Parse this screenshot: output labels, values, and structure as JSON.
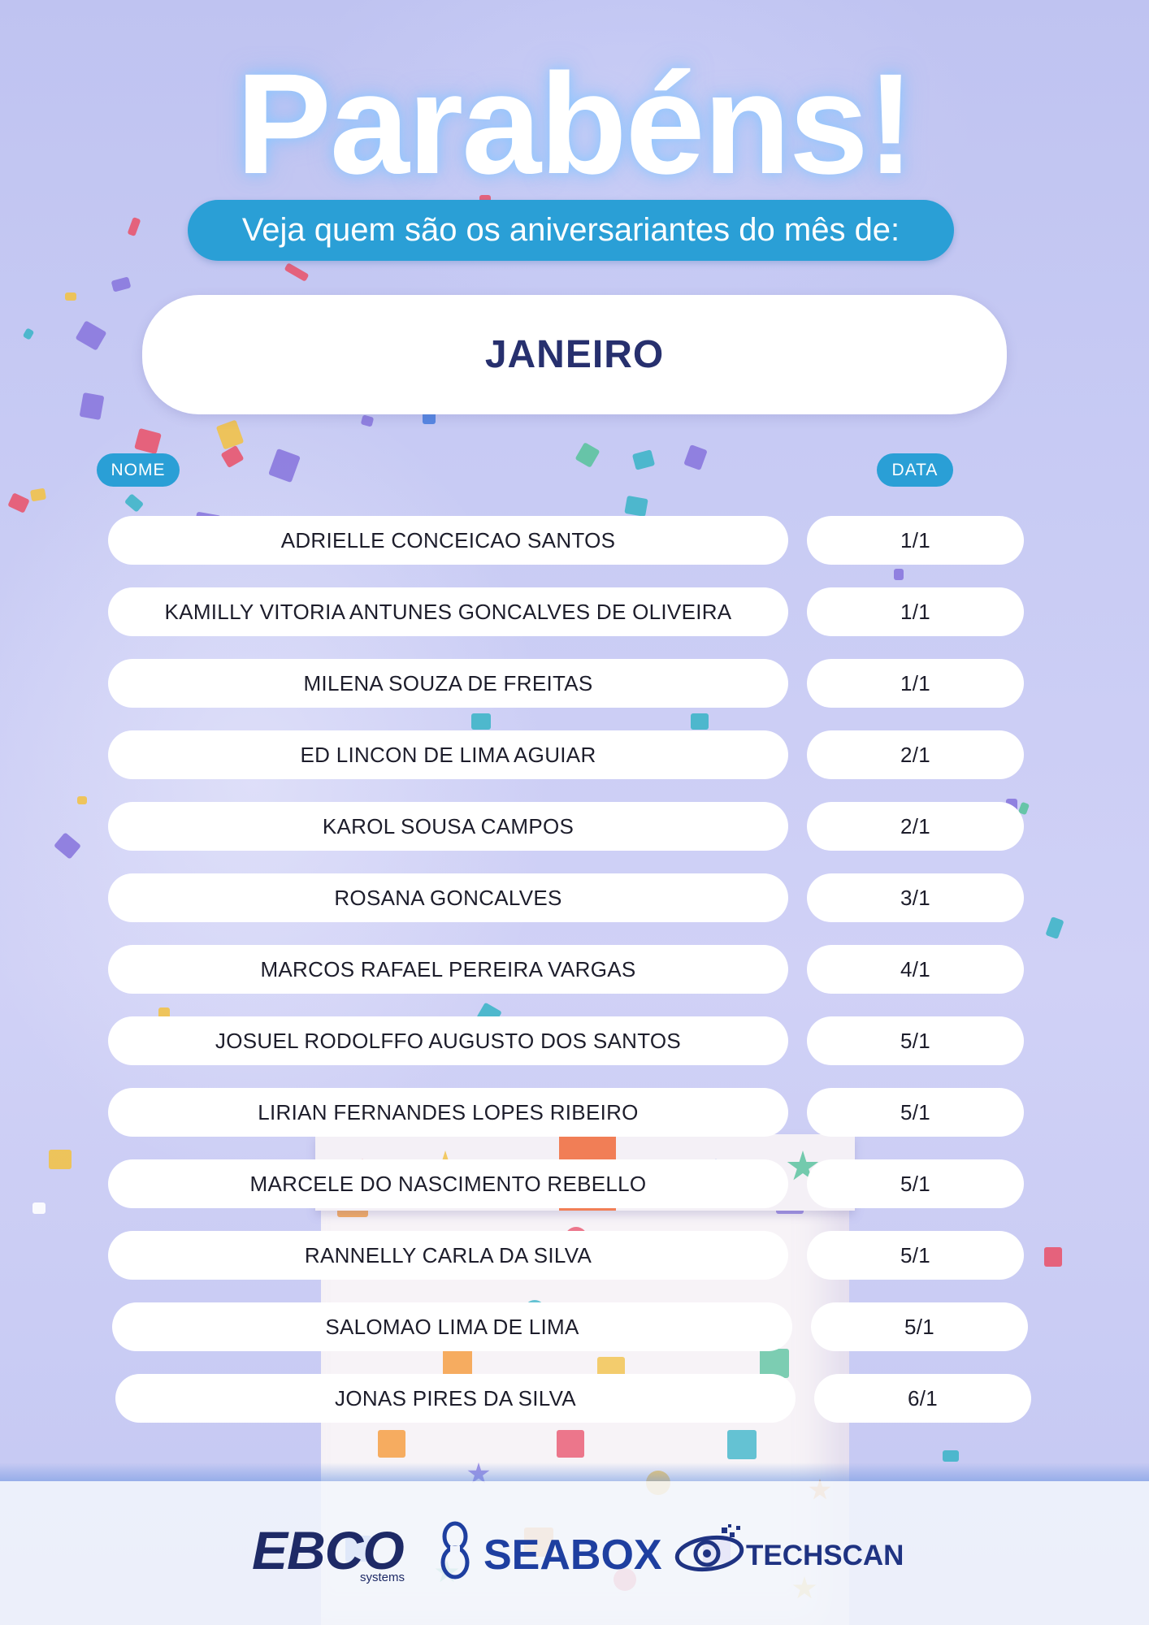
{
  "header": {
    "title": "Parabéns!",
    "subtitle": "Veja quem são os aniversariantes do mês de:"
  },
  "month": "JANEIRO",
  "table": {
    "name_header": "NOME",
    "date_header": "DATA",
    "rows": [
      {
        "name": "ADRIELLE CONCEICAO SANTOS",
        "date": "1/1"
      },
      {
        "name": "KAMILLY VITORIA ANTUNES GONCALVES DE OLIVEIRA",
        "date": "1/1"
      },
      {
        "name": "MILENA SOUZA DE FREITAS",
        "date": "1/1"
      },
      {
        "name": "ED LINCON DE LIMA AGUIAR",
        "date": "2/1"
      },
      {
        "name": "KAROL SOUSA CAMPOS",
        "date": "2/1"
      },
      {
        "name": "ROSANA GONCALVES",
        "date": "3/1"
      },
      {
        "name": "MARCOS RAFAEL PEREIRA VARGAS",
        "date": "4/1"
      },
      {
        "name": "JOSUEL RODOLFFO AUGUSTO DOS SANTOS",
        "date": "5/1"
      },
      {
        "name": "LIRIAN FERNANDES LOPES RIBEIRO",
        "date": "5/1"
      },
      {
        "name": "MARCELE DO NASCIMENTO REBELLO",
        "date": "5/1"
      },
      {
        "name": "RANNELLY CARLA DA SILVA",
        "date": "5/1"
      },
      {
        "name": "SALOMAO LIMA DE LIMA",
        "date": "5/1"
      },
      {
        "name": "JONAS PIRES DA SILVA",
        "date": "6/1"
      }
    ]
  },
  "footer": {
    "logos": [
      {
        "name": "EBCO",
        "tagline": "systems",
        "icon": "ebco-logo"
      },
      {
        "name": "SEABOX",
        "icon": "seabox-loop-icon"
      },
      {
        "name": "TECHSCAN",
        "icon": "techscan-eye-icon"
      }
    ]
  },
  "colors": {
    "accent": "#2a9fd6",
    "navy": "#27306e",
    "row_text": "#1d1d2b",
    "background": "#c8cbf4"
  }
}
